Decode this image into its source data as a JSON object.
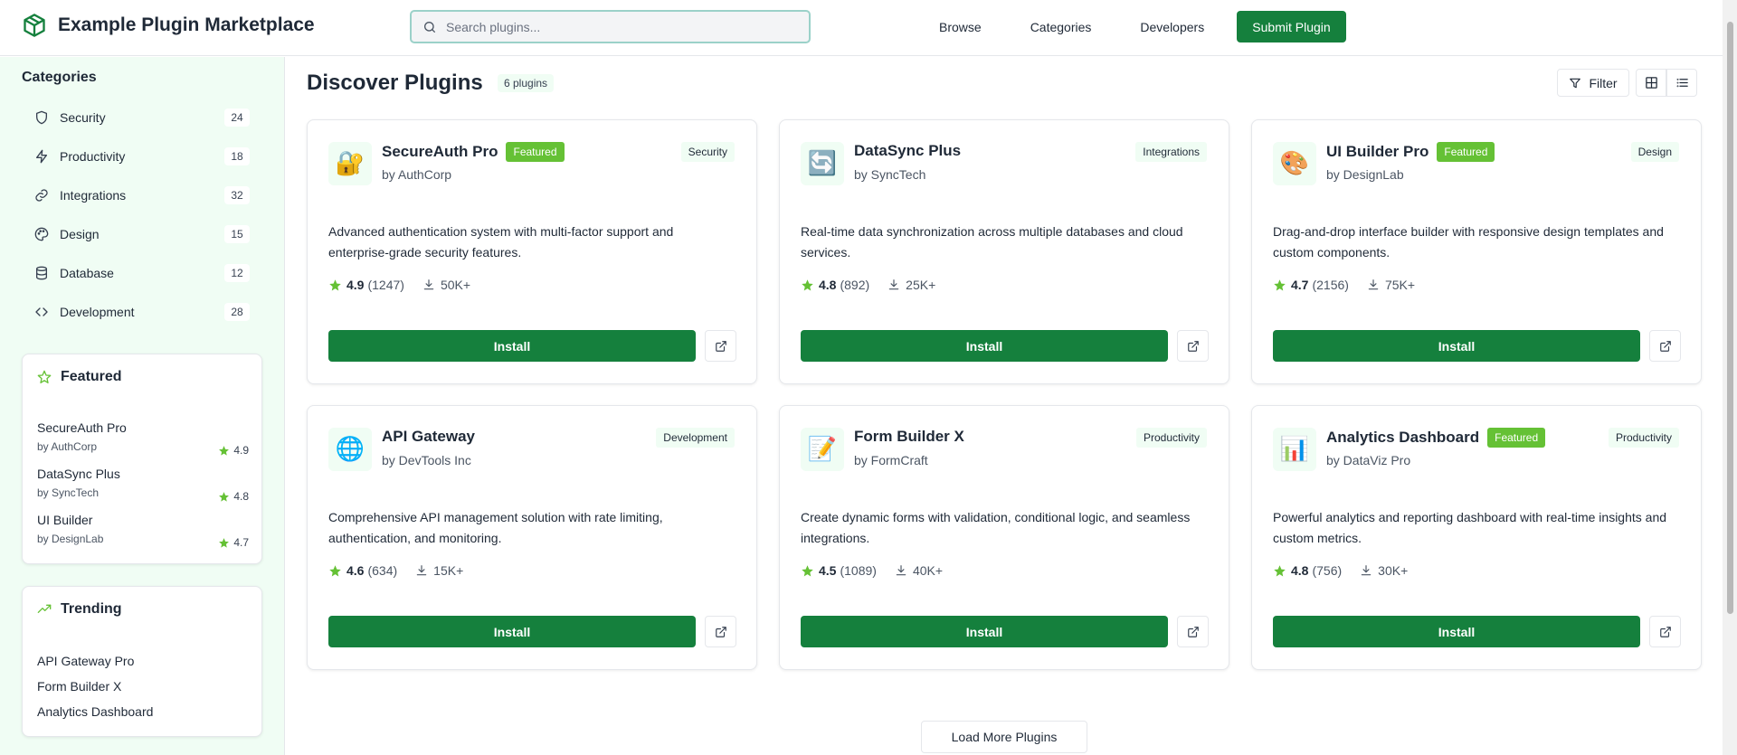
{
  "header": {
    "app_title": "Example Plugin Marketplace",
    "search_placeholder": "Search plugins...",
    "nav": [
      "Browse",
      "Categories",
      "Developers"
    ],
    "submit_label": "Submit Plugin"
  },
  "sidebar": {
    "categories_title": "Categories",
    "categories": [
      {
        "icon": "shield-icon",
        "label": "Security",
        "count": "24"
      },
      {
        "icon": "lightning-icon",
        "label": "Productivity",
        "count": "18"
      },
      {
        "icon": "link-icon",
        "label": "Integrations",
        "count": "32"
      },
      {
        "icon": "palette-icon",
        "label": "Design",
        "count": "15"
      },
      {
        "icon": "database-icon",
        "label": "Database",
        "count": "12"
      },
      {
        "icon": "code-icon",
        "label": "Development",
        "count": "28"
      }
    ],
    "featured_title": "Featured",
    "featured": [
      {
        "name": "SecureAuth Pro",
        "by": "by AuthCorp",
        "rating": "4.9"
      },
      {
        "name": "DataSync Plus",
        "by": "by SyncTech",
        "rating": "4.8"
      },
      {
        "name": "UI Builder",
        "by": "by DesignLab",
        "rating": "4.7"
      }
    ],
    "trending_title": "Trending",
    "trending": [
      "API Gateway Pro",
      "Form Builder X",
      "Analytics Dashboard"
    ]
  },
  "main": {
    "title": "Discover Plugins",
    "count_badge": "6 plugins",
    "filter_label": "Filter",
    "install_label": "Install",
    "load_more_label": "Load More Plugins",
    "featured_badge": "Featured",
    "plugins": [
      {
        "icon": "🔐",
        "name": "SecureAuth Pro",
        "featured": true,
        "author": "by AuthCorp",
        "category": "Security",
        "description": "Advanced authentication system with multi-factor support and enterprise-grade security features.",
        "rating": "4.9",
        "reviews": "(1247)",
        "downloads": "50K+"
      },
      {
        "icon": "🔄",
        "name": "DataSync Plus",
        "featured": false,
        "author": "by SyncTech",
        "category": "Integrations",
        "description": "Real-time data synchronization across multiple databases and cloud services.",
        "rating": "4.8",
        "reviews": "(892)",
        "downloads": "25K+"
      },
      {
        "icon": "🎨",
        "name": "UI Builder Pro",
        "featured": true,
        "author": "by DesignLab",
        "category": "Design",
        "description": "Drag-and-drop interface builder with responsive design templates and custom components.",
        "rating": "4.7",
        "reviews": "(2156)",
        "downloads": "75K+"
      },
      {
        "icon": "🌐",
        "name": "API Gateway",
        "featured": false,
        "author": "by DevTools Inc",
        "category": "Development",
        "description": "Comprehensive API management solution with rate limiting, authentication, and monitoring.",
        "rating": "4.6",
        "reviews": "(634)",
        "downloads": "15K+"
      },
      {
        "icon": "📝",
        "name": "Form Builder X",
        "featured": false,
        "author": "by FormCraft",
        "category": "Productivity",
        "description": "Create dynamic forms with validation, conditional logic, and seamless integrations.",
        "rating": "4.5",
        "reviews": "(1089)",
        "downloads": "40K+"
      },
      {
        "icon": "📊",
        "name": "Analytics Dashboard",
        "featured": true,
        "author": "by DataViz Pro",
        "category": "Productivity",
        "description": "Powerful analytics and reporting dashboard with real-time insights and custom metrics.",
        "rating": "4.8",
        "reviews": "(756)",
        "downloads": "30K+"
      }
    ]
  },
  "colors": {
    "primary": "#15803d",
    "featured_badge": "#65c135",
    "star": "#65c135",
    "sidebar_bg": "#f0fdf4"
  }
}
